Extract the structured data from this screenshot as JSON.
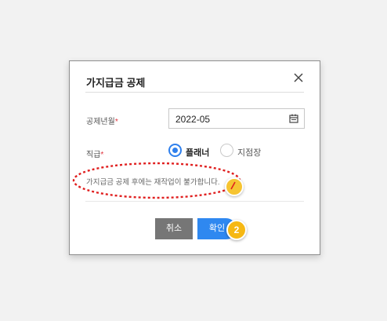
{
  "dialog": {
    "title": "가지급금 공제",
    "month_field": {
      "label": "공제년월",
      "required_mark": "*",
      "value": "2022-05"
    },
    "position_field": {
      "label": "직급",
      "required_mark": "*",
      "options": [
        {
          "label": "플래너",
          "selected": true
        },
        {
          "label": "지점장",
          "selected": false
        }
      ]
    },
    "notice": "가지급금 공제 후에는 재작업이 불가합니다.",
    "buttons": {
      "cancel": "취소",
      "confirm": "확인"
    }
  },
  "annotations": {
    "step_badge": "2",
    "colors": {
      "badge": "#f6b814",
      "highlight_ellipse": "#e02020",
      "primary": "#2f88f0",
      "cancel": "#767676"
    }
  }
}
